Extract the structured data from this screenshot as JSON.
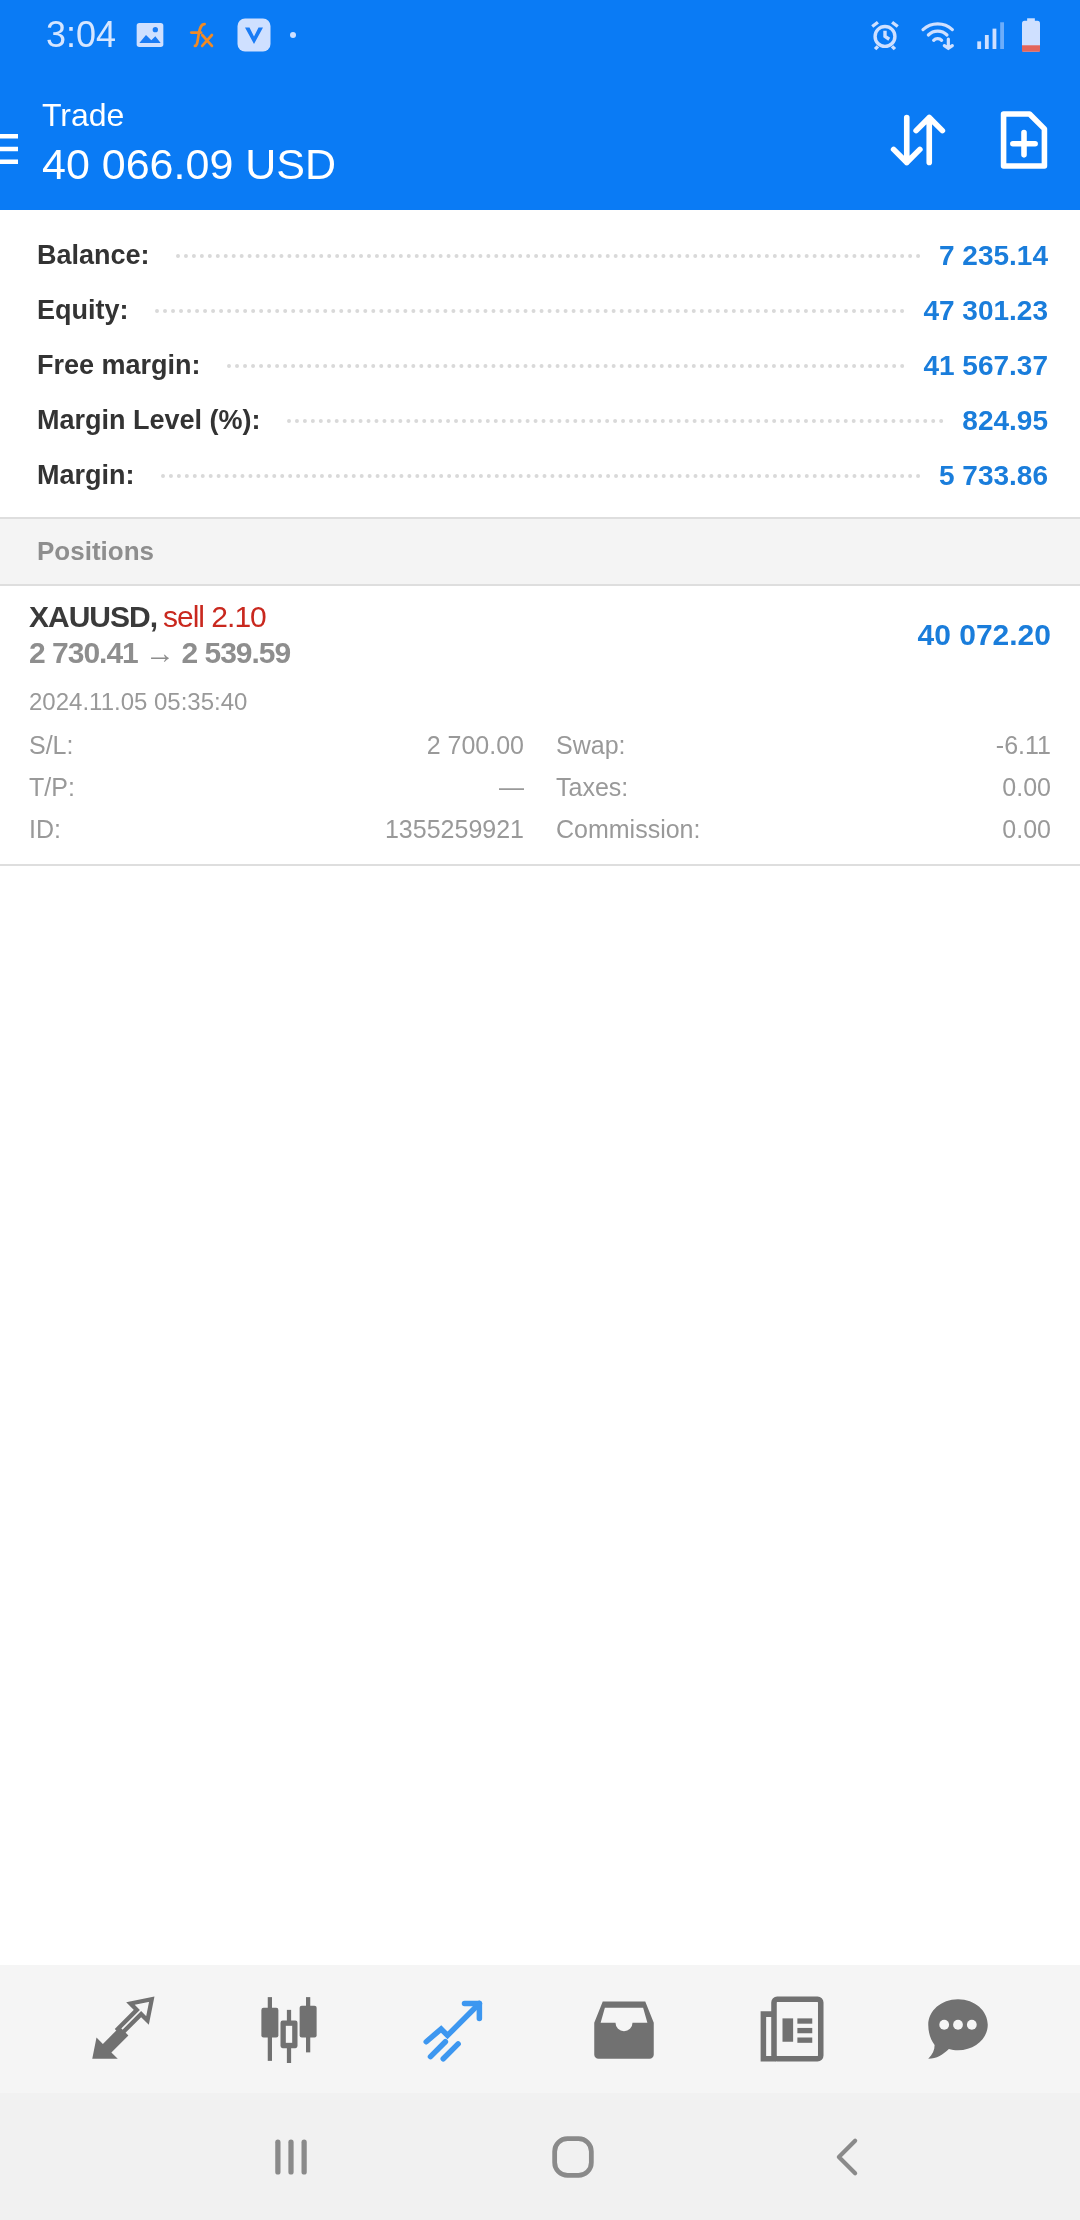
{
  "status_bar": {
    "time": "3:04"
  },
  "app_bar": {
    "title": "Trade",
    "subtitle": "40 066.09 USD"
  },
  "summary": [
    {
      "label": "Balance:",
      "value": "7 235.14"
    },
    {
      "label": "Equity:",
      "value": "47 301.23"
    },
    {
      "label": "Free margin:",
      "value": "41 567.37"
    },
    {
      "label": "Margin Level (%):",
      "value": "824.95"
    },
    {
      "label": "Margin:",
      "value": "5 733.86"
    }
  ],
  "positions": {
    "header": "Positions",
    "items": [
      {
        "symbol": "XAUUSD,",
        "side": "sell 2.10",
        "prices": "2 730.41 → 2 539.59",
        "profit": "40 072.20",
        "time": "2024.11.05 05:35:40",
        "details": [
          {
            "label": "S/L:",
            "value": "2 700.00"
          },
          {
            "label": "Swap:",
            "value": "-6.11"
          },
          {
            "label": "T/P:",
            "value": "—"
          },
          {
            "label": "Taxes:",
            "value": "0.00"
          },
          {
            "label": "ID:",
            "value": "1355259921"
          },
          {
            "label": "Commission:",
            "value": "0.00"
          }
        ]
      }
    ]
  },
  "bottom_nav": [
    {
      "kind": "quotes",
      "selected": false
    },
    {
      "kind": "chart",
      "selected": false
    },
    {
      "kind": "trade",
      "selected": true
    },
    {
      "kind": "history",
      "selected": false
    },
    {
      "kind": "news",
      "selected": false
    },
    {
      "kind": "messages",
      "selected": false
    }
  ]
}
